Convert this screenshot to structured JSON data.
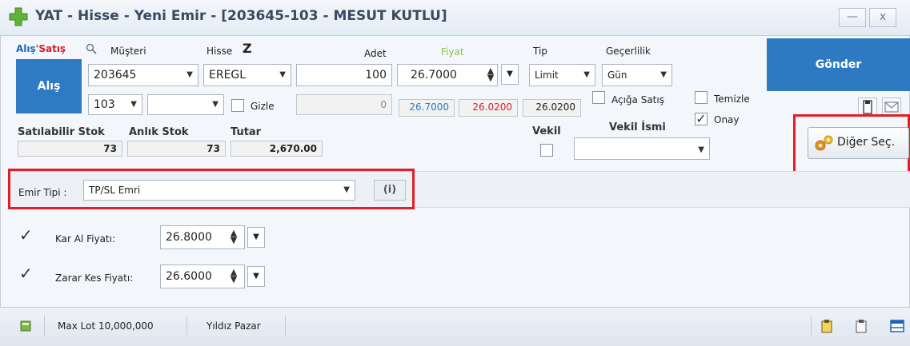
{
  "window": {
    "title": "YAT - Hisse - Yeni Emir - [203645-103 - MESUT KUTLU]",
    "minimize_label": "—",
    "close_label": "x"
  },
  "header": {
    "alis_label": "Alış",
    "separator": "'",
    "satis_label": "Satış",
    "musteri_label": "Müşteri",
    "hisse_label": "Hisse",
    "z_label": "Z",
    "adet_label": "Adet",
    "fiyat_label": "Fiyat",
    "tip_label": "Tip",
    "gecerlilik_label": "Geçerlilik"
  },
  "order": {
    "side_button": "Alış",
    "musteri_value": "203645",
    "hisse_value": "EREGL",
    "adet_value": "100",
    "fiyat_value": "26.7000",
    "tip_value": "Limit",
    "gecerlilik_value": "Gün",
    "sub_account": "103",
    "sub_account2": "",
    "gizle_label": "Gizle",
    "gizle_value": "0",
    "price_ask": "26.7000",
    "price_bid": "26.0200",
    "price_last": "26.0200",
    "aciga_satis_label": "Açığa Satış",
    "temizle_label": "Temizle",
    "onay_label": "Onay",
    "onay_checked": "✓"
  },
  "stock": {
    "satilabilir_label": "Satılabilir Stok",
    "anlik_label": "Anlık Stok",
    "tutar_label": "Tutar",
    "satilabilir_value": "73",
    "anlik_value": "73",
    "tutar_value": "2,670.00",
    "vekil_label": "Vekil",
    "vekil_ismi_label": "Vekil İsmi",
    "vekil_ismi_value": ""
  },
  "actions": {
    "send_label": "Gönder",
    "other_options_label": "Diğer Seç."
  },
  "emir_tipi": {
    "label": "Emir Tipi :",
    "value": "TP/SL Emri",
    "info_label": "(i)"
  },
  "tp_sl": {
    "kar_al_label": "Kar Al Fiyatı:",
    "kar_al_value": "26.8000",
    "kar_al_checked": "✓",
    "zarar_kes_label": "Zarar Kes Fiyatı:",
    "zarar_kes_value": "26.6000",
    "zarar_kes_checked": "✓"
  },
  "statusbar": {
    "max_lot": "Max Lot 10,000,000",
    "market": "Yıldız Pazar"
  },
  "colors": {
    "accent": "#2e7ac2",
    "highlight": "#e11d25",
    "satis": "#d4202a",
    "fiyat_label": "#8fc04a"
  }
}
